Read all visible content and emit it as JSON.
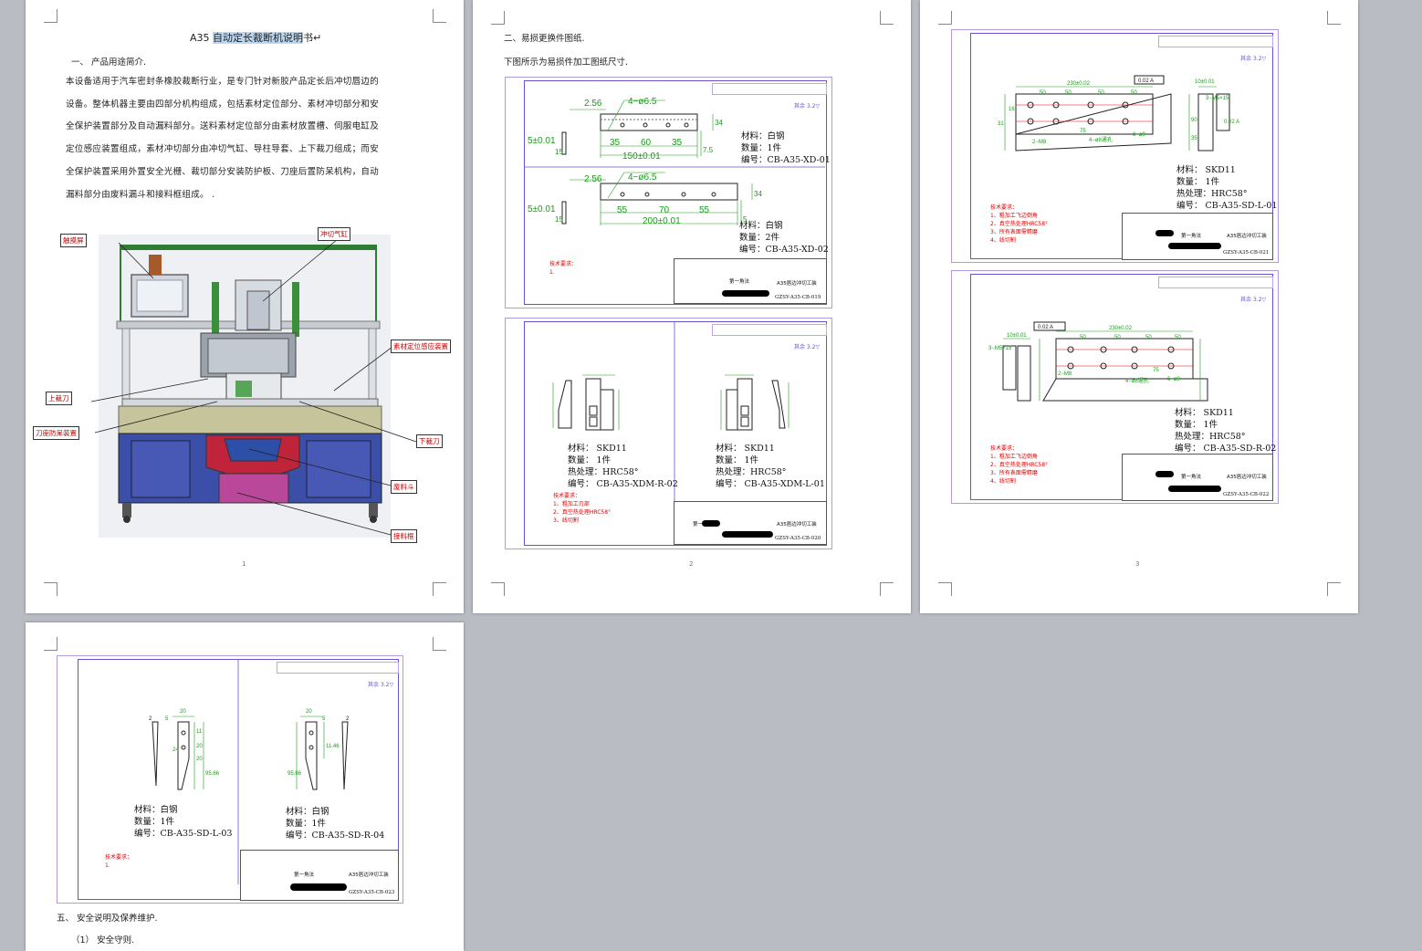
{
  "pages": [
    {
      "number": "1"
    },
    {
      "number": "2"
    },
    {
      "number": "3"
    }
  ],
  "page1": {
    "title_prefix": "A35 ",
    "title_selected": "自动定长裁断机说明",
    "title_suffix": "书↵",
    "section1": "一、   产品用途简介.",
    "lines": [
      "本设备适用于汽车密封条橡胶裁断行业，是专门针对新胶产品定长后冲切唇边的",
      "设备。整体机器主要由四部分机构组成，包括素材定位部分、素材冲切部分和安",
      "全保护装置部分及自动漏料部分。送料素材定位部分由素材放置槽、伺服电缸及",
      "定位感应装置组成，素材冲切部分由冲切气缸、导柱导套、上下裁刀组成；而安",
      "全保护装置采用外置安全光栅、裁切部分安装防护板、刀座后置防呆机构，自动",
      "漏料部分由废料漏斗和接料框组成。   ."
    ],
    "callouts": [
      "触摸屏",
      "冲切气缸",
      "素材定位感应装置",
      "上裁刀",
      "刀座防呆装置",
      "下裁刀",
      "废料斗",
      "接料框"
    ]
  },
  "page2": {
    "section2": "二、易损更换件图纸.",
    "intro": "下图所示为易损件加工图纸尺寸.",
    "drawing_a_parts": [
      {
        "lines": [
          "材料：白钢",
          "数量：1件",
          "编号：CB-A35-XD-01"
        ]
      },
      {
        "lines": [
          "材料：白钢",
          "数量：2件",
          "编号：CB-A35-XD-02"
        ]
      }
    ],
    "drawing_a_dims": {
      "top": [
        "2.56",
        "4−ø6.5",
        "5±0.01",
        "15",
        "35",
        "60",
        "35",
        "150±0.01",
        "34",
        "7.5"
      ],
      "bottom": [
        "2.56",
        "4−ø6.5",
        "5±0.01",
        "15",
        "55",
        "70",
        "55",
        "200±0.01",
        "34",
        "5"
      ]
    },
    "drawing_a_req": [
      "技术要求：",
      "1."
    ],
    "drawing_a_code": "GZSY-A35-CB-019",
    "drawing_b_parts": [
      {
        "lines": [
          "材料：  SKD11",
          "数量：  1件",
          "热处理：HRC58°",
          "编号：  CB-A35-XDM-R-02"
        ]
      },
      {
        "lines": [
          "材料：  SKD11",
          "数量：  1件",
          "热处理：HRC58°",
          "编号：  CB-A35-XDM-L-01"
        ]
      }
    ],
    "drawing_b_req": [
      "技术要求：",
      "1、粗加工刃部",
      "2、真空热处理HRC58°",
      "3、线切割"
    ],
    "drawing_b_code": "GZSY-A35-CB-020"
  },
  "page3": {
    "drawing_c_part": [
      "材料：  SKD11",
      "数量：  1件",
      "热处理：HRC58°",
      "编号：  CB-A35-SD-L-01"
    ],
    "drawing_c_dims": [
      "230±0.02",
      "50",
      "50",
      "50",
      "50",
      "0.02 A",
      "10±0.01",
      "3−M5×15",
      "75",
      "4−ø8通孔",
      "6−ø9",
      "2−M8",
      "16",
      "31",
      "90",
      "35",
      "0.02 A"
    ],
    "drawing_c_req": [
      "技术要求：",
      "1、粗加工飞边倒角",
      "2、真空热处理HRC58°",
      "3、所有表面需精磨",
      "4、线切割"
    ],
    "drawing_c_code": "GZSY-A35-CB-021",
    "drawing_d_part": [
      "材料：  SKD11",
      "数量：  1件",
      "热处理：HRC58°",
      "编号：  CB-A35-SD-R-02"
    ],
    "drawing_d_dims": [
      "10±0.01",
      "0.02 A",
      "230±0.02",
      "50",
      "50",
      "50",
      "50",
      "3−M5×15",
      "2−M8",
      "75",
      "4−ø8通孔",
      "6−ø9"
    ],
    "drawing_d_req": [
      "技术要求：",
      "1、粗加工飞边倒角",
      "2、真空热处理HRC58°",
      "3、所有表面需精磨",
      "4、线切割"
    ],
    "drawing_d_code": "GZSY-A35-CB-022"
  },
  "page4": {
    "drawing_e_parts": [
      {
        "lines": [
          "材料：白钢",
          "数量：1件",
          "编号：CB-A35-SD-L-03"
        ]
      },
      {
        "lines": [
          "材料：白钢",
          "数量：1件",
          "编号：CB-A35-SD-R-04"
        ]
      }
    ],
    "drawing_e_dims": [
      "2",
      "5",
      "20",
      "24",
      "11",
      "20",
      "20",
      "95.66",
      "11.46",
      "20",
      "5",
      "2",
      "95.66"
    ],
    "drawing_e_req": [
      "技术要求：",
      "1."
    ],
    "drawing_e_code": "GZSY-A35-CB-023",
    "section5": "五、  安全说明及保养维护.",
    "sub1": "（1）  安全守则."
  },
  "titleblock": {
    "projection": "第一角法",
    "name": "A35唇边冲切工装",
    "rough_label": "其余",
    "rough_value": "3.2"
  }
}
